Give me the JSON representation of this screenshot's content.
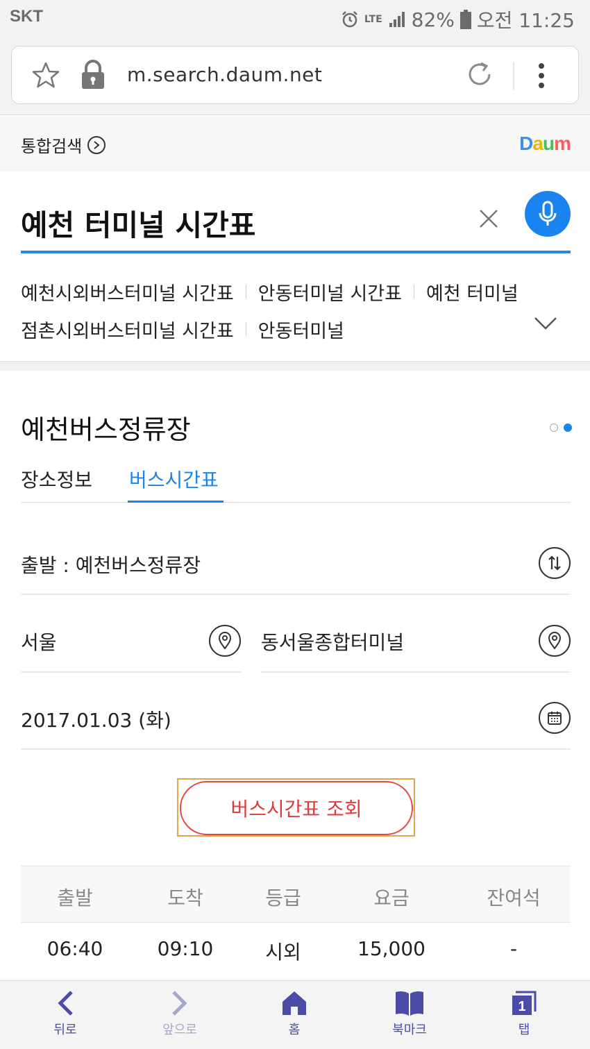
{
  "status_bar": {
    "carrier": "SKT",
    "network": "LTE",
    "battery": "82%",
    "time": "오전 11:25"
  },
  "browser": {
    "url": "m.search.daum.net"
  },
  "search": {
    "section_label": "통합검색",
    "logo": "Daum",
    "query": "예천 터미널 시간표",
    "suggestions_row1": [
      "예천시외버스터미널 시간표",
      "안동터미널 시간표",
      "예천 터미널"
    ],
    "suggestions_row2": [
      "점촌시외버스터미널 시간표",
      "안동터미널"
    ]
  },
  "card": {
    "title": "예천버스정류장",
    "pager": {
      "current": 2,
      "total": 2
    },
    "tabs": [
      "장소정보",
      "버스시간표"
    ],
    "active_tab": "버스시간표",
    "departure": "출발 : 예천버스정류장",
    "from_city": "서울",
    "to_terminal": "동서울종합터미널",
    "date": "2017.01.03 (화)",
    "query_button": "버스시간표 조회",
    "table": {
      "headers": [
        "출발",
        "도착",
        "등급",
        "요금",
        "잔여석"
      ],
      "rows": [
        [
          "06:40",
          "09:10",
          "시외",
          "15,000",
          "-"
        ]
      ]
    }
  },
  "bottom_nav": {
    "back": "뒤로",
    "forward": "앞으로",
    "home": "홈",
    "bookmarks": "북마크",
    "tabs": "탭",
    "tab_count": "1"
  },
  "colors": {
    "accent": "#1a84ee",
    "button_red": "#e03b3b",
    "nav_icon": "#4b4ba8"
  }
}
